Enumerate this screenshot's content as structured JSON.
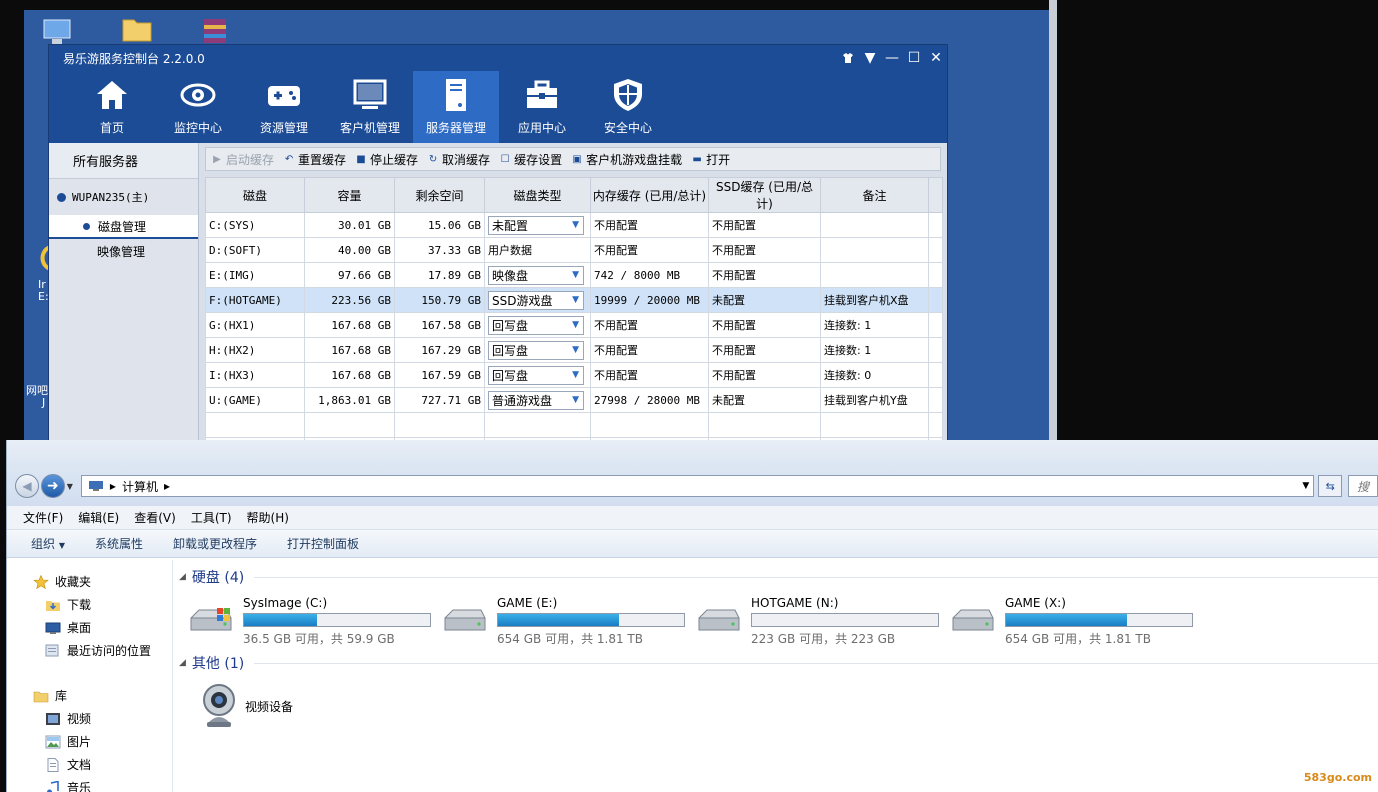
{
  "console": {
    "title": "易乐游服务控制台 2.2.0.0",
    "nav": [
      {
        "label": "首页",
        "icon": "home-icon"
      },
      {
        "label": "监控中心",
        "icon": "eye-icon"
      },
      {
        "label": "资源管理",
        "icon": "gamepad-icon"
      },
      {
        "label": "客户机管理",
        "icon": "monitor-icon"
      },
      {
        "label": "服务器管理",
        "icon": "server-icon",
        "active": true
      },
      {
        "label": "应用中心",
        "icon": "toolbox-icon"
      },
      {
        "label": "安全中心",
        "icon": "shield-icon"
      }
    ],
    "sidebar": {
      "all_servers": "所有服务器",
      "server_name": "WUPAN235(主)",
      "disk_mgmt": "磁盘管理",
      "image_mgmt": "映像管理"
    },
    "toolbar": {
      "start_cache": "启动缓存",
      "reset_cache": "重置缓存",
      "stop_cache": "停止缓存",
      "cancel_cache": "取消缓存",
      "cache_settings": "缓存设置",
      "client_mount": "客户机游戏盘挂载",
      "open": "打开"
    },
    "table": {
      "headers": [
        "磁盘",
        "容量",
        "剩余空间",
        "磁盘类型",
        "内存缓存 (已用/总计)",
        "SSD缓存 (已用/总计)",
        "备注"
      ],
      "rows": [
        {
          "disk": "C:(SYS)",
          "capacity": "30.01 GB",
          "free": "15.06 GB",
          "type": "未配置",
          "type_select": true,
          "mem": "不用配置",
          "ssd": "不用配置",
          "note": ""
        },
        {
          "disk": "D:(SOFT)",
          "capacity": "40.00 GB",
          "free": "37.33 GB",
          "type": "用户数据",
          "type_select": false,
          "mem": "不用配置",
          "ssd": "不用配置",
          "note": ""
        },
        {
          "disk": "E:(IMG)",
          "capacity": "97.66 GB",
          "free": "17.89 GB",
          "type": "映像盘",
          "type_select": true,
          "mem": "742 / 8000 MB",
          "ssd": "不用配置",
          "note": ""
        },
        {
          "disk": "F:(HOTGAME)",
          "capacity": "223.56 GB",
          "free": "150.79 GB",
          "type": "SSD游戏盘",
          "type_select": true,
          "mem": "19999 / 20000 MB",
          "ssd": "未配置",
          "note": "挂载到客户机X盘",
          "selected": true
        },
        {
          "disk": "G:(HX1)",
          "capacity": "167.68 GB",
          "free": "167.58 GB",
          "type": "回写盘",
          "type_select": true,
          "mem": "不用配置",
          "ssd": "不用配置",
          "note": "连接数: 1"
        },
        {
          "disk": "H:(HX2)",
          "capacity": "167.68 GB",
          "free": "167.29 GB",
          "type": "回写盘",
          "type_select": true,
          "mem": "不用配置",
          "ssd": "不用配置",
          "note": "连接数: 1"
        },
        {
          "disk": "I:(HX3)",
          "capacity": "167.68 GB",
          "free": "167.59 GB",
          "type": "回写盘",
          "type_select": true,
          "mem": "不用配置",
          "ssd": "不用配置",
          "note": "连接数: 0"
        },
        {
          "disk": "U:(GAME)",
          "capacity": "1,863.01 GB",
          "free": "727.71 GB",
          "type": "普通游戏盘",
          "type_select": true,
          "mem": "27998 / 28000 MB",
          "ssd": "未配置",
          "note": "挂载到客户机Y盘"
        }
      ]
    }
  },
  "desktop": {
    "fragments": [
      "Ir",
      "E:",
      "网吧",
      "J"
    ]
  },
  "explorer": {
    "address": {
      "location": "计算机"
    },
    "search_placeholder": "搜",
    "menu": [
      "文件(F)",
      "编辑(E)",
      "查看(V)",
      "工具(T)",
      "帮助(H)"
    ],
    "commands": {
      "organize": "组织",
      "system_props": "系统属性",
      "uninstall": "卸载或更改程序",
      "control_panel": "打开控制面板"
    },
    "nav": {
      "favorites": "收藏夹",
      "downloads": "下载",
      "desktop": "桌面",
      "recent": "最近访问的位置",
      "libraries": "库",
      "videos": "视频",
      "pictures": "图片",
      "documents": "文档",
      "music": "音乐"
    },
    "hard_disks_header": "硬盘 (4)",
    "drives": [
      {
        "name": "SysImage (C:)",
        "info": "36.5 GB 可用，共 59.9 GB",
        "used_fraction": 0.39,
        "system": true
      },
      {
        "name": "GAME (E:)",
        "info": "654 GB 可用，共 1.81 TB",
        "used_fraction": 0.65,
        "system": false
      },
      {
        "name": "HOTGAME (N:)",
        "info": "223 GB 可用，共 223 GB",
        "used_fraction": 0.0,
        "system": false
      },
      {
        "name": "GAME (X:)",
        "info": "654 GB 可用，共 1.81 TB",
        "used_fraction": 0.65,
        "system": false
      }
    ],
    "other_header": "其他 (1)",
    "other_items": [
      {
        "name": "视频设备"
      }
    ]
  },
  "watermark": "583go.com",
  "colors": {
    "console_blue": "#1d4c96",
    "nav_active": "#2e6bc4",
    "selected_row": "#cfe2f7",
    "drive_fill": "#1a7ec4"
  }
}
